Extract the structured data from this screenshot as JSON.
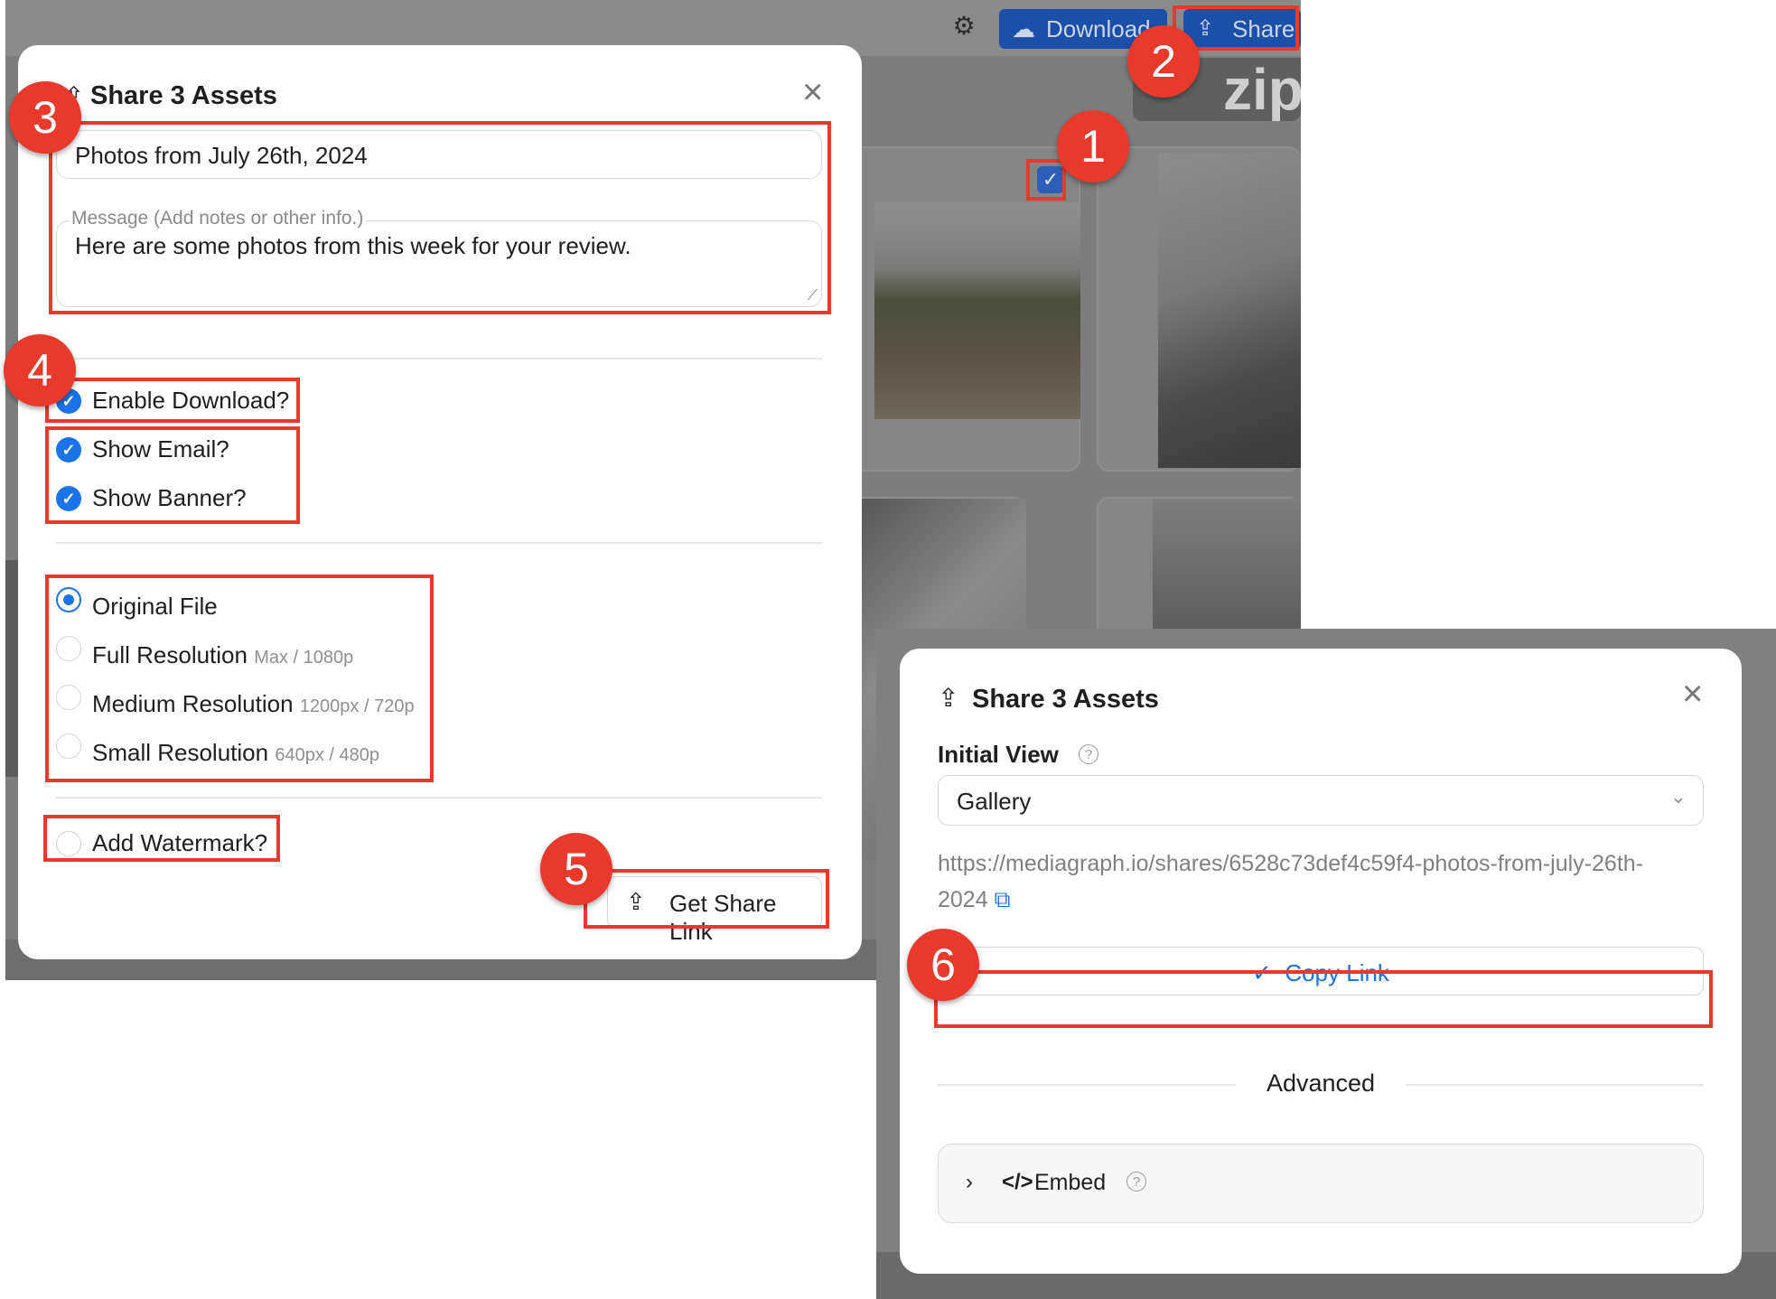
{
  "background_app": {
    "download_label": "Download",
    "share_label": "Share",
    "zip_label": "zip"
  },
  "share_modal": {
    "title": "Share 3 Assets",
    "title_field_value": "Photos from July 26th, 2024",
    "message_label": "Message (Add notes or other info.)",
    "message_value": "Here are some photos from this week for your review.",
    "toggles": [
      {
        "label": "Enable Download?",
        "checked": true
      },
      {
        "label": "Show Email?",
        "checked": true
      },
      {
        "label": "Show Banner?",
        "checked": true
      }
    ],
    "resolutions": [
      {
        "label": "Original File",
        "sub": "",
        "selected": true
      },
      {
        "label": "Full Resolution",
        "sub": "Max / 1080p",
        "selected": false
      },
      {
        "label": "Medium Resolution",
        "sub": "1200px / 720p",
        "selected": false
      },
      {
        "label": "Small Resolution",
        "sub": "640px / 480p",
        "selected": false
      }
    ],
    "watermark_label": "Add Watermark?",
    "watermark_checked": false,
    "get_link_label": "Get Share Link"
  },
  "link_modal": {
    "title": "Share 3 Assets",
    "initial_view_label": "Initial View",
    "initial_view_value": "Gallery",
    "url_line1": "https://mediagraph.io/shares/6528c73def4c59f4-photos-from-july-26th-",
    "url_line2": "2024",
    "copy_label": "Copy Link",
    "advanced_label": "Advanced",
    "embed_label": "Embed"
  },
  "annotations": [
    "1",
    "2",
    "3",
    "4",
    "5",
    "6"
  ],
  "colors": {
    "accent": "#1a73e8",
    "annotation": "#e8392c",
    "overlay": "#7d7d7d"
  }
}
